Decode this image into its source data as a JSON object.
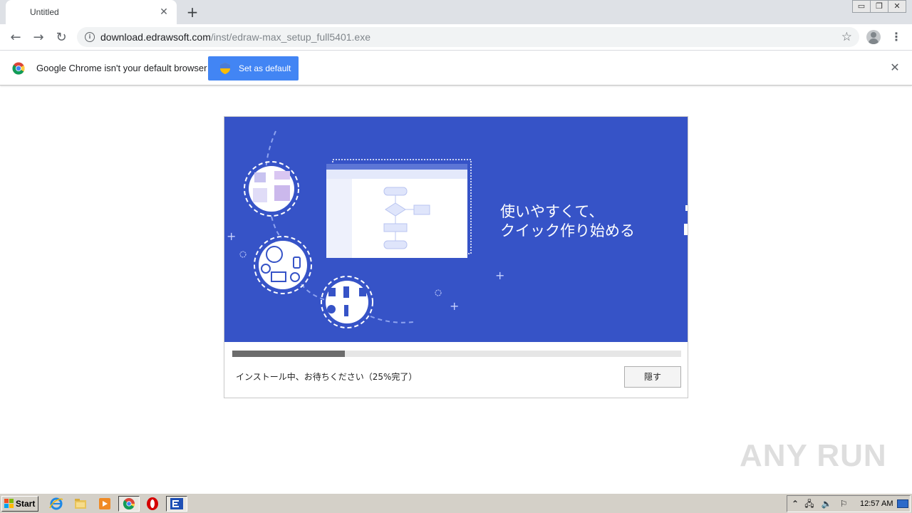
{
  "browser": {
    "tab_title": "Untitled",
    "url_host": "download.edrawsoft.com",
    "url_path": "/inst/edraw-max_setup_full5401.exe"
  },
  "infobar": {
    "message": "Google Chrome isn't your default browser",
    "button_label": "Set as default"
  },
  "installer": {
    "headline_line1": "使いやすくて、",
    "headline_line2": "クイック作り始める",
    "progress_fraction": 0.25,
    "status_text": "インストール中、お待ちください（25%完了）",
    "hide_button_label": "隠す",
    "banner_color": "#3653c7"
  },
  "watermark": {
    "text": "ANY RUN"
  },
  "taskbar": {
    "start_label": "Start",
    "clock": "12:57 AM",
    "pinned": [
      "internet-explorer-icon",
      "file-explorer-icon",
      "media-player-icon",
      "chrome-icon",
      "opera-icon",
      "edraw-icon"
    ]
  }
}
